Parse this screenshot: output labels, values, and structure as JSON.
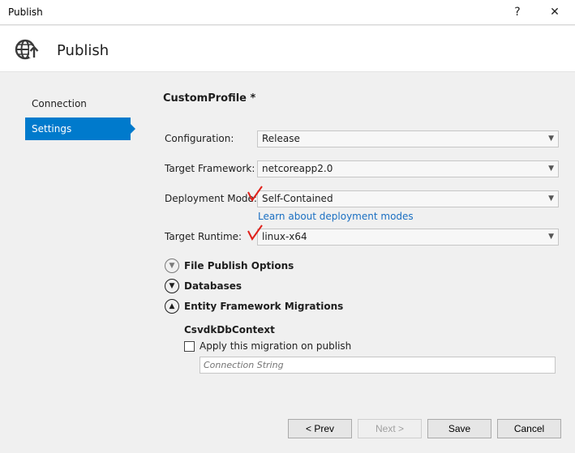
{
  "window": {
    "title": "Publish",
    "help_glyph": "?",
    "close_glyph": "✕"
  },
  "header": {
    "title": "Publish",
    "icon": "globe-publish-icon"
  },
  "nav": {
    "items": [
      {
        "label": "Connection",
        "active": false
      },
      {
        "label": "Settings",
        "active": true
      }
    ]
  },
  "profile": {
    "name": "CustomProfile *"
  },
  "form": {
    "configuration": {
      "label": "Configuration:",
      "value": "Release"
    },
    "framework": {
      "label": "Target Framework:",
      "value": "netcoreapp2.0"
    },
    "deployment": {
      "label": "Deployment Mode:",
      "value": "Self-Contained",
      "link": "Learn about deployment modes"
    },
    "runtime": {
      "label": "Target Runtime:",
      "value": "linux-x64"
    }
  },
  "sections": {
    "file_publish": "File Publish Options",
    "databases": "Databases",
    "ef_migrations": "Entity Framework Migrations"
  },
  "migration": {
    "context": "CsvdkDbContext",
    "apply_label": "Apply this migration on publish",
    "apply_checked": false,
    "connection_placeholder": "Connection String"
  },
  "buttons": {
    "prev": "< Prev",
    "next": "Next >",
    "save": "Save",
    "cancel": "Cancel"
  },
  "colors": {
    "accent": "#007acc",
    "link": "#1a6fc2",
    "annotation": "#e0201a"
  }
}
